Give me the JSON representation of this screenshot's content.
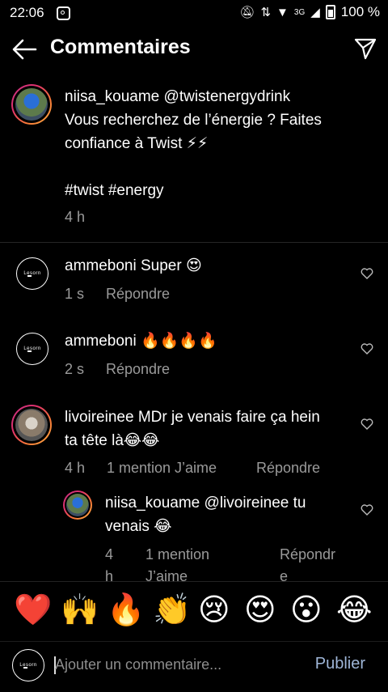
{
  "status": {
    "time": "22:06",
    "battery": "100 %",
    "network": "3G"
  },
  "header": {
    "title": "Commentaires"
  },
  "post": {
    "username": "niisa_kouame",
    "mention": "@twistenergydrink",
    "line1": "Vous recherchez de l’énergie ? Faites",
    "line2": "confiance à Twist ⚡⚡",
    "hashtags": "#twist #energy",
    "time": "4 h"
  },
  "comments": [
    {
      "username": "ammeboni",
      "text": "Super 😍",
      "time": "1 s",
      "reply": "Répondre"
    },
    {
      "username": "ammeboni",
      "text": "🔥🔥🔥🔥",
      "time": "2 s",
      "reply": "Répondre"
    },
    {
      "username": "livoireinee",
      "text1": "MDr je venais faire ça hein",
      "text2": "ta tête là😂😂",
      "time": "4 h",
      "likes": "1 mention J’aime",
      "reply": "Répondre"
    }
  ],
  "reply_comment": {
    "username": "niisa_kouame",
    "text1": "@livoireinee tu",
    "text2": "venais 😂",
    "time1": "4",
    "time2": "h",
    "likes1": "1 mention",
    "likes2": "J’aime",
    "reply1": "Répondr",
    "reply2": "e"
  },
  "emojis": [
    "❤️",
    "🙌",
    "🔥",
    "👏",
    "😢",
    "😍",
    "😮",
    "😂"
  ],
  "composer": {
    "placeholder": "Ajouter un commentaire...",
    "publish": "Publier"
  },
  "avatar_text": "Lesorn"
}
